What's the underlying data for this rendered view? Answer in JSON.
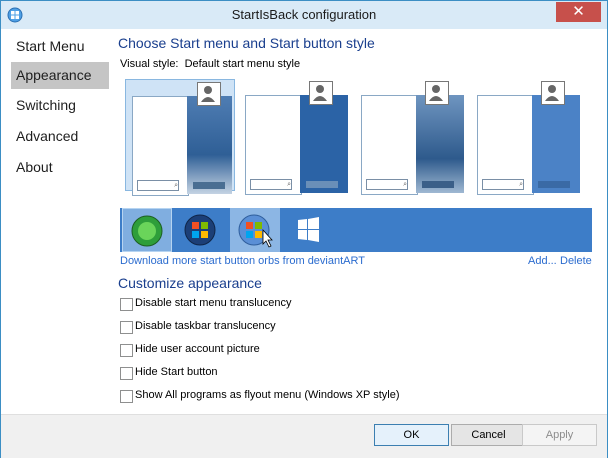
{
  "window": {
    "title": "StartIsBack configuration",
    "close_glyph": "✕",
    "app_icon": "startisback-orb-icon"
  },
  "nav": {
    "items": [
      {
        "label": "Start Menu",
        "selected": false
      },
      {
        "label": "Appearance",
        "selected": true
      },
      {
        "label": "Switching",
        "selected": false
      },
      {
        "label": "Advanced",
        "selected": false
      },
      {
        "label": "About",
        "selected": false
      }
    ]
  },
  "style_section": {
    "heading": "Choose Start menu and Start button style",
    "visual_style_label": "Visual style:",
    "visual_style_value": "Default start menu style",
    "thumbnails": [
      {
        "name": "default",
        "selected": true,
        "right_color": "#2f5f96"
      },
      {
        "name": "plain-aero",
        "selected": false,
        "right_color": "#2b63a6"
      },
      {
        "name": "windows-7",
        "selected": false,
        "right_color": "#2e5a8c"
      },
      {
        "name": "windows-8",
        "selected": false,
        "right_color": "#4b82c6"
      }
    ],
    "orbs": [
      {
        "name": "green-orb",
        "selected": true
      },
      {
        "name": "windows-7-orb",
        "selected": false
      },
      {
        "name": "windows-7-orb-hover",
        "selected": false
      },
      {
        "name": "windows-8-logo",
        "selected": false
      }
    ],
    "download_link": "Download more start button orbs from deviantART",
    "add_link": "Add...",
    "delete_link": "Delete"
  },
  "customize": {
    "heading": "Customize appearance",
    "options": [
      {
        "label": "Disable start menu translucency",
        "checked": false
      },
      {
        "label": "Disable taskbar translucency",
        "checked": false
      },
      {
        "label": "Hide user account picture",
        "checked": false
      },
      {
        "label": "Hide Start button",
        "checked": false
      },
      {
        "label": "Show All programs as flyout menu (Windows XP style)",
        "checked": false
      }
    ]
  },
  "footer": {
    "ok_label": "OK",
    "cancel_label": "Cancel",
    "apply_label": "Apply"
  },
  "colors": {
    "accent_heading": "#1a3f8e",
    "link": "#2b6ccf",
    "orbs_bar": "#3d7dc8",
    "close_button": "#c7504b"
  }
}
